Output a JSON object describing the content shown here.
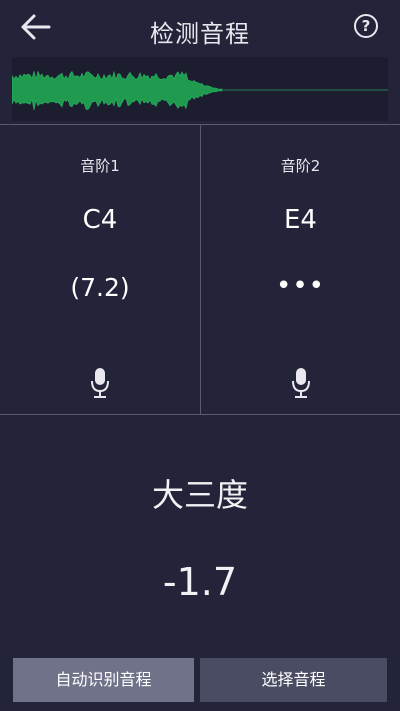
{
  "header": {
    "title": "检测音程",
    "help_label": "?"
  },
  "note1": {
    "label": "音阶1",
    "name": "C4",
    "value": "(7.2)"
  },
  "note2": {
    "label": "音阶2",
    "name": "E4",
    "value": "•••"
  },
  "interval": {
    "name": "大三度",
    "value": "-1.7"
  },
  "buttons": {
    "auto_label": "自动识别音程",
    "select_label": "选择音程"
  },
  "colors": {
    "background": "#23233a",
    "waveform": "#1f9a4e",
    "button_active": "#6f7289",
    "button": "#4a4c63"
  }
}
